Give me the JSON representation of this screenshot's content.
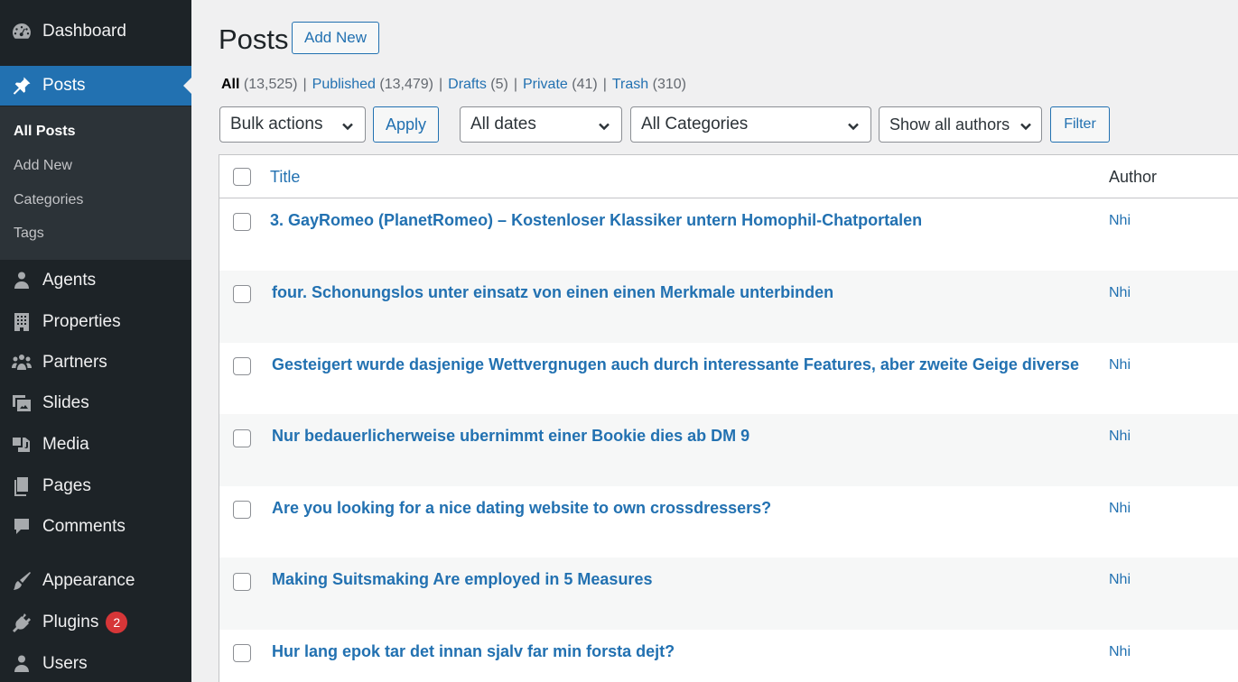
{
  "sidebar": {
    "items": [
      {
        "label": "Dashboard",
        "icon": "dashboard-icon"
      },
      {
        "label": "Posts",
        "icon": "pin-icon"
      },
      {
        "label": "Agents",
        "icon": "person-icon"
      },
      {
        "label": "Properties",
        "icon": "building-icon"
      },
      {
        "label": "Partners",
        "icon": "groups-icon"
      },
      {
        "label": "Slides",
        "icon": "slides-icon"
      },
      {
        "label": "Media",
        "icon": "media-icon"
      },
      {
        "label": "Pages",
        "icon": "pages-icon"
      },
      {
        "label": "Comments",
        "icon": "comment-icon"
      },
      {
        "label": "Appearance",
        "icon": "brush-icon"
      },
      {
        "label": "Plugins",
        "icon": "plugin-icon",
        "badge": "2"
      },
      {
        "label": "Users",
        "icon": "users-icon"
      }
    ],
    "submenu": [
      "All Posts",
      "Add New",
      "Categories",
      "Tags"
    ]
  },
  "header": {
    "title": "Posts",
    "add_new": "Add New"
  },
  "filters": {
    "views": [
      {
        "label": "All",
        "count": "(13,525)"
      },
      {
        "label": "Published",
        "count": "(13,479)"
      },
      {
        "label": "Drafts",
        "count": "(5)"
      },
      {
        "label": "Private",
        "count": "(41)"
      },
      {
        "label": "Trash",
        "count": "(310)"
      }
    ],
    "separator": "|",
    "bulk_actions": "Bulk actions",
    "apply": "Apply",
    "dates": "All dates",
    "categories": "All Categories",
    "authors": "Show all authors",
    "filter": "Filter"
  },
  "table": {
    "columns": {
      "title": "Title",
      "author": "Author"
    },
    "rows": [
      {
        "title": "3. GayRomeo (PlanetRomeo) – Kostenloser Klassiker untern Homophil-Chatportalen",
        "author": "Nhi"
      },
      {
        "title": "four. Schonungslos unter einsatz von einen einen Merkmale unterbinden",
        "author": "Nhi"
      },
      {
        "title": "Gesteigert wurde dasjenige Wettvergnugen auch durch interessante Features, aber zweite Geige diverse",
        "author": "Nhi"
      },
      {
        "title": "Nur bedauerlicherweise ubernimmt einer Bookie dies ab DM 9",
        "author": "Nhi"
      },
      {
        "title": "Are you looking for a nice dating website to own crossdressers?",
        "author": "Nhi"
      },
      {
        "title": "Making Suitsmaking Are employed in 5 Measures",
        "author": "Nhi"
      },
      {
        "title": "Hur lang epok tar det innan sjalv far min forsta dejt?",
        "author": "Nhi"
      }
    ]
  },
  "colors": {
    "accent": "#2271b1",
    "sidebar": "#1d2327",
    "badge": "#d63638"
  }
}
